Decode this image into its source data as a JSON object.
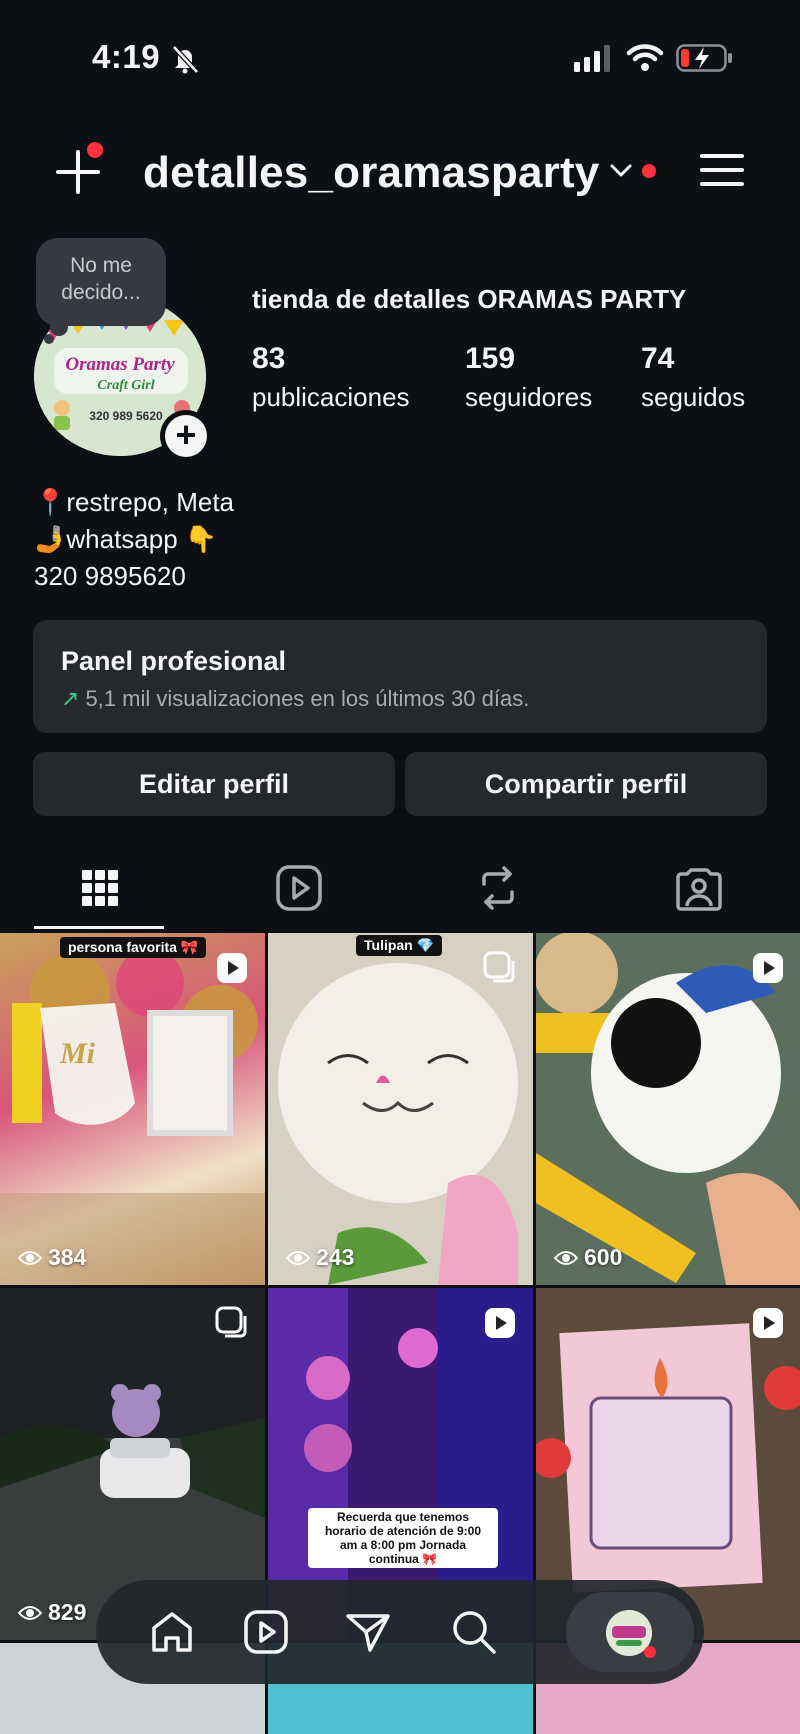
{
  "status_bar": {
    "time": "4:19"
  },
  "header": {
    "username": "detalles_oramasparty"
  },
  "profile": {
    "note": "No me decido...",
    "full_name": "tienda de detalles ORAMAS PARTY",
    "stats": [
      {
        "value": "83",
        "label": "publicaciones"
      },
      {
        "value": "159",
        "label": "seguidores"
      },
      {
        "value": "74",
        "label": "seguidos"
      }
    ],
    "bio": [
      "📍restrepo, Meta",
      "🤳whatsapp 👇",
      "320 9895620"
    ],
    "avatar_text": {
      "line1": "Oramas Party",
      "line2": "Craft Girl",
      "phone": "320 989 5620"
    }
  },
  "panel": {
    "title": "Panel profesional",
    "subtitle": "5,1 mil visualizaciones en los últimos 30 días."
  },
  "buttons": {
    "edit": "Editar perfil",
    "share": "Compartir perfil"
  },
  "tabs": [
    "grid-icon",
    "reels-icon",
    "reposts-icon",
    "tagged-icon"
  ],
  "grid": [
    {
      "views": "384",
      "type": "reel",
      "caption": "persona favorita 🎀"
    },
    {
      "views": "243",
      "type": "carousel",
      "caption": "Tulipan 💎"
    },
    {
      "views": "600",
      "type": "reel",
      "caption": ""
    },
    {
      "views": "829",
      "type": "carousel",
      "caption": ""
    },
    {
      "views": "",
      "type": "reel",
      "caption": "Recuerda que tenemos horario de atención de 9:00 am a 8:00 pm Jornada continua 🎀"
    },
    {
      "views": "",
      "type": "reel",
      "caption": ""
    }
  ],
  "nav": [
    "home-icon",
    "reels-icon",
    "messages-icon",
    "search-icon",
    "profile-avatar"
  ],
  "colors": {
    "background": "#0c1014",
    "surface": "#25292e",
    "notification": "#ff3040",
    "trend": "#3fca8a"
  }
}
